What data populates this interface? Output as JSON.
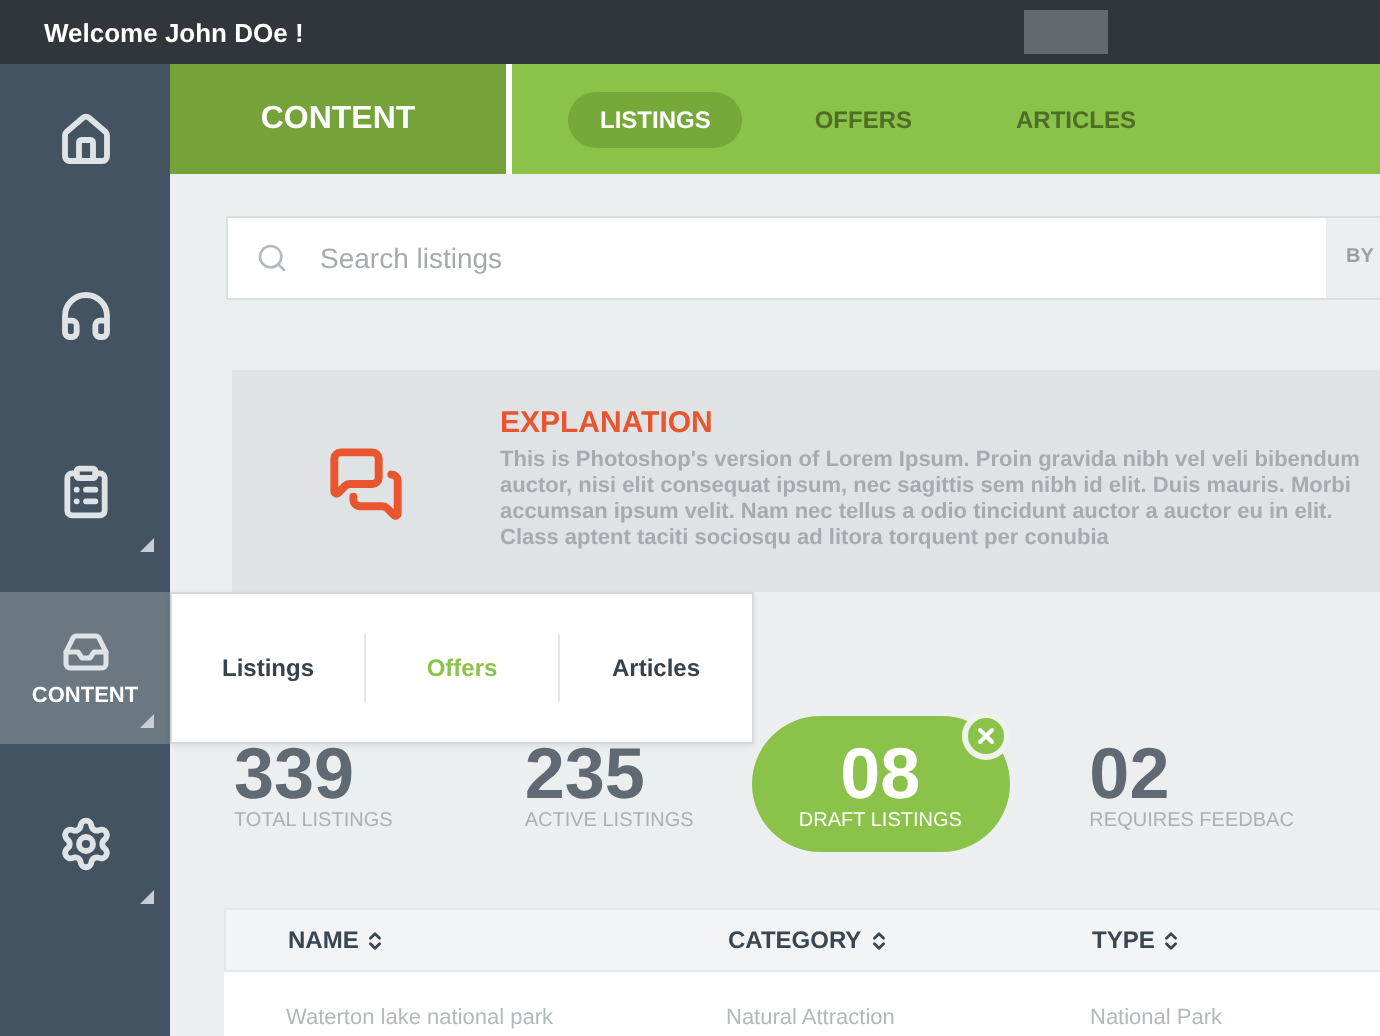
{
  "top_bar": {
    "welcome": "Welcome John DOe !"
  },
  "sidebar": {
    "items": [
      {
        "selected": false,
        "submenu": false
      },
      {
        "selected": false,
        "submenu": false
      },
      {
        "selected": false,
        "submenu": true
      },
      {
        "label": "CONTENT",
        "selected": true,
        "submenu": true
      },
      {
        "selected": false,
        "submenu": true
      }
    ]
  },
  "popup_menu": {
    "items": [
      {
        "label": "Listings",
        "selected": false
      },
      {
        "label": "Offers",
        "selected": true
      },
      {
        "label": "Articles",
        "selected": false
      }
    ]
  },
  "header": {
    "section": "CONTENT",
    "tabs": [
      {
        "label": "LISTINGS",
        "selected": true
      },
      {
        "label": "OFFERS",
        "selected": false
      },
      {
        "label": "ARTICLES",
        "selected": false
      }
    ]
  },
  "search": {
    "placeholder": "Search listings",
    "by_button": "BY"
  },
  "explanation": {
    "title": "EXPLANATION",
    "text": "This is Photoshop's version  of Lorem Ipsum. Proin gravida nibh vel veli bibendum auctor, nisi elit consequat ipsum, nec sagittis sem nibh id elit. Duis mauris. Morbi accumsan ipsum velit. Nam nec tellus a odio tincidunt auctor a auctor eu in elit. Class aptent taciti sociosqu ad litora torquent per conubia"
  },
  "stats": [
    {
      "value": "339",
      "label": "TOTAL LISTINGS",
      "selected": false
    },
    {
      "value": "235",
      "label": "ACTIVE LISTINGS",
      "selected": false
    },
    {
      "value": "08",
      "label": "DRAFT LISTINGS",
      "selected": true
    },
    {
      "value": "02",
      "label": "REQUIRES FEEDBAC",
      "selected": false
    }
  ],
  "table": {
    "columns": [
      "NAME",
      "CATEGORY",
      "TYPE"
    ],
    "rows": [
      [
        "Waterton lake national park",
        "Natural Attraction",
        "National Park"
      ]
    ]
  }
}
